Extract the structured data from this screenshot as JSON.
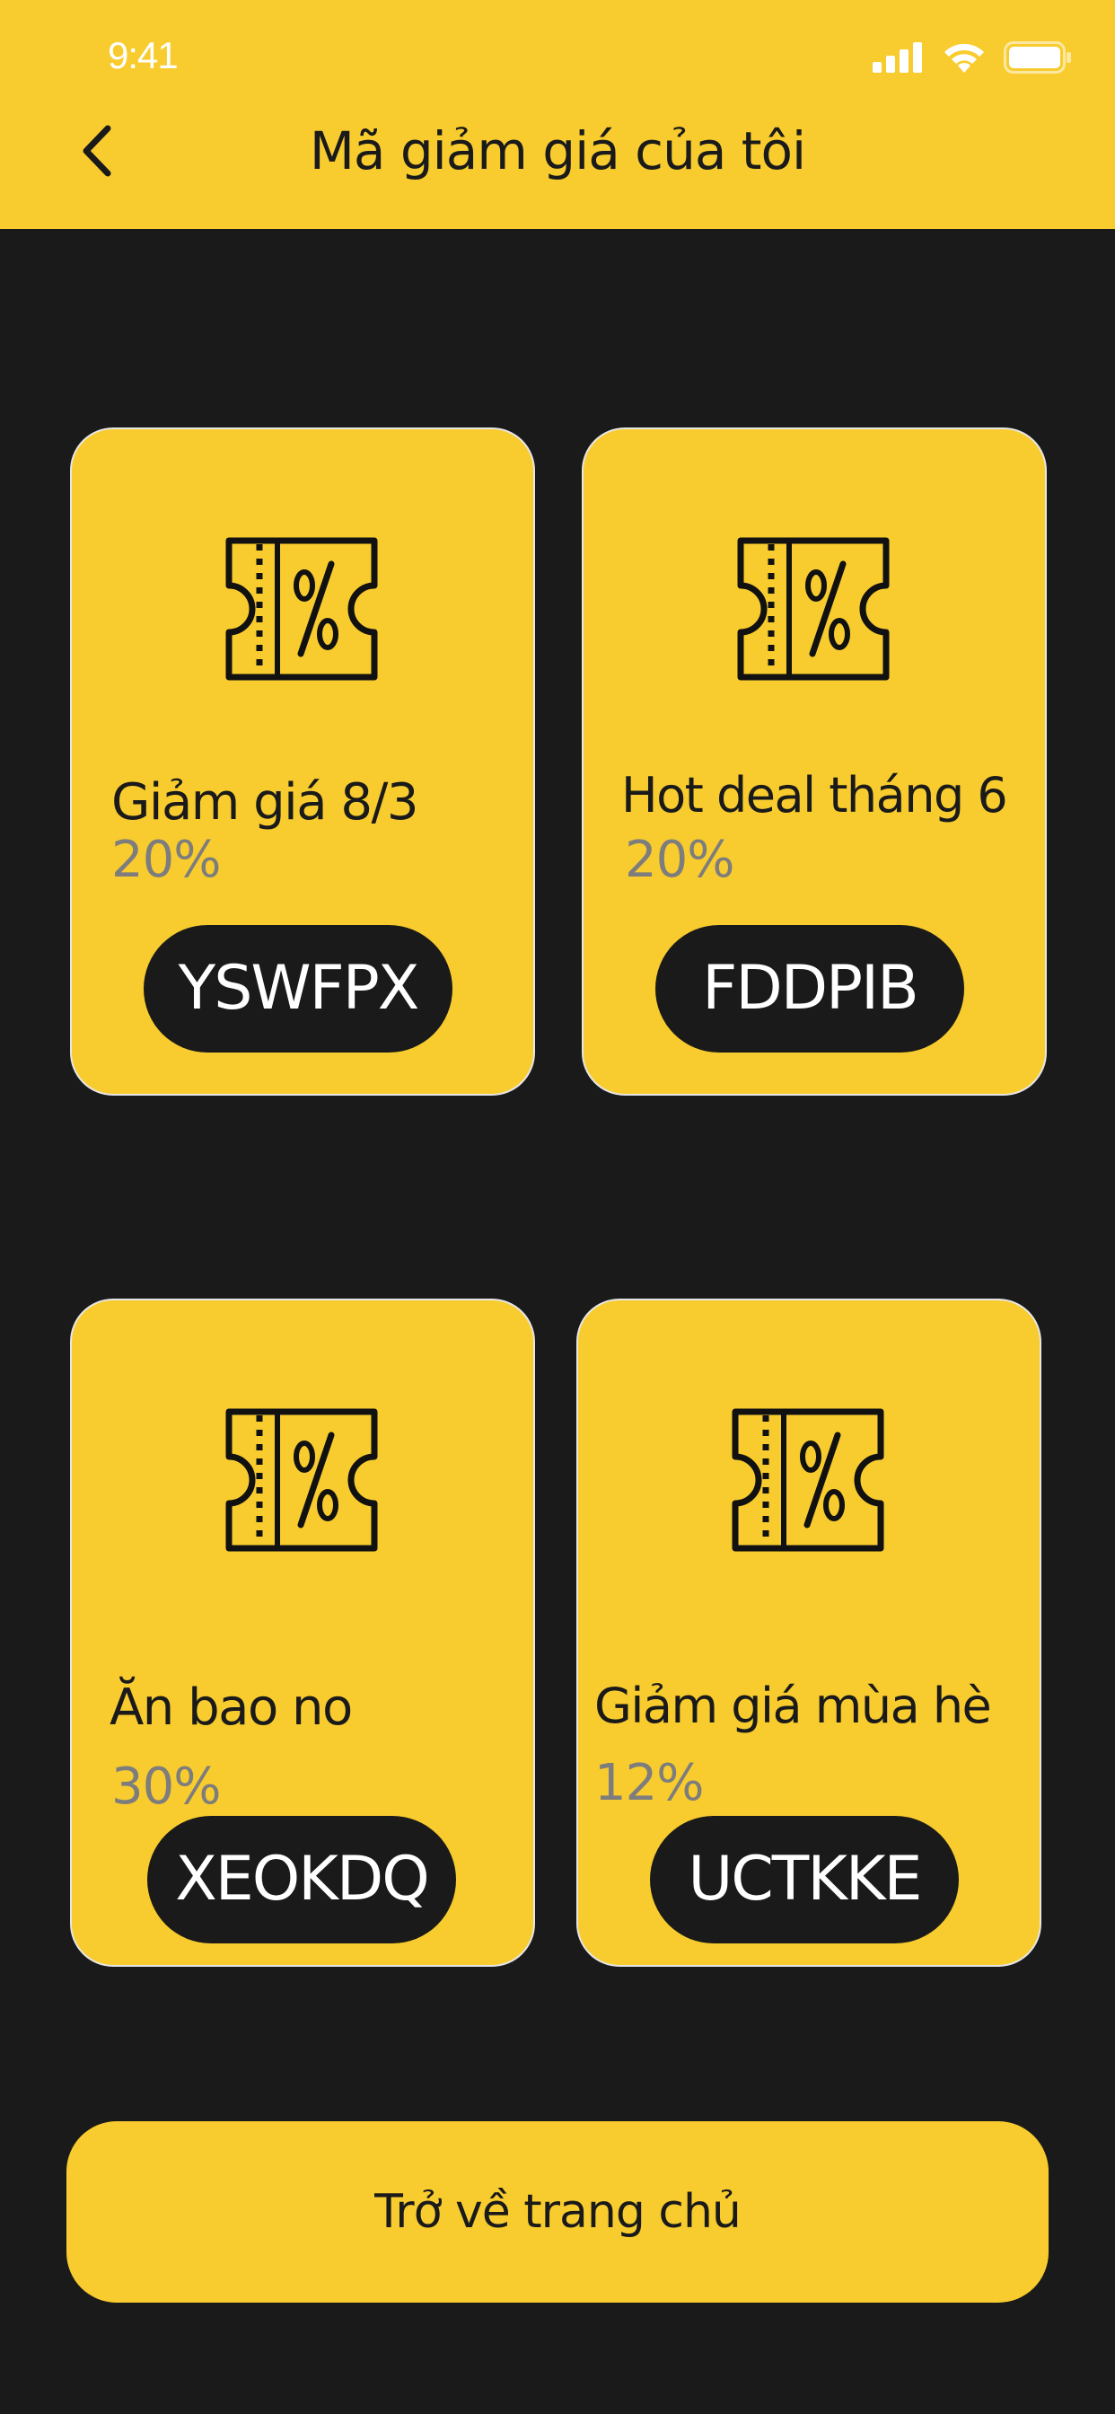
{
  "status_bar": {
    "time": "9:41",
    "signal_icon": "cellular-signal-icon",
    "wifi_icon": "wifi-icon",
    "battery_icon": "battery-icon"
  },
  "header": {
    "title": "Mã giảm giá của tôi",
    "back_icon": "chevron-left-icon"
  },
  "coupons": [
    {
      "name": "Giảm giá 8/3",
      "percent": "20%",
      "code": "YSWFPX",
      "icon": "ticket-percent-icon"
    },
    {
      "name": "Hot deal tháng 6",
      "percent": "20%",
      "code": "FDDPIB",
      "icon": "ticket-percent-icon"
    },
    {
      "name": "Ăn bao no",
      "percent": "30%",
      "code": "XEOKDQ",
      "icon": "ticket-percent-icon"
    },
    {
      "name": "Giảm giá mùa hè",
      "percent": "12%",
      "code": "UCTKKE",
      "icon": "ticket-percent-icon"
    }
  ],
  "footer": {
    "home_button_label": "Trở về trang chủ"
  },
  "colors": {
    "accent": "#f8cc2e",
    "background": "#1a1a1a",
    "muted_text": "#7d7d7d"
  }
}
